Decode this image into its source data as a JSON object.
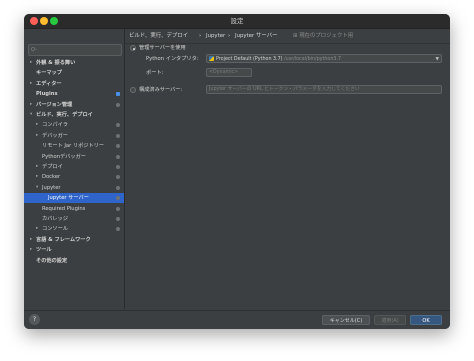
{
  "window": {
    "title": "設定"
  },
  "search": {
    "placeholder": "Q-"
  },
  "sidebar": {
    "items": [
      {
        "label": "外観 & 振る舞い",
        "arrow": "▸",
        "bold": true
      },
      {
        "label": "キーマップ",
        "arrow": "",
        "bold": true
      },
      {
        "label": "エディター",
        "arrow": "▸",
        "bold": true
      },
      {
        "label": "Plugins",
        "arrow": "",
        "bold": true
      },
      {
        "label": "バージョン管理",
        "arrow": "▸",
        "bold": true
      },
      {
        "label": "ビルド、実行、デプロイ",
        "arrow": "▾",
        "bold": true
      },
      {
        "label": "コンパイラ",
        "arrow": "▸",
        "bold": false
      },
      {
        "label": "デバッガー",
        "arrow": "▸",
        "bold": false
      },
      {
        "label": "リモート Jar リポジトリー",
        "arrow": "",
        "bold": false
      },
      {
        "label": "Pythonデバッガー",
        "arrow": "",
        "bold": false
      },
      {
        "label": "デプロイ",
        "arrow": "▸",
        "bold": false
      },
      {
        "label": "Docker",
        "arrow": "▸",
        "bold": false
      },
      {
        "label": "Jupyter",
        "arrow": "▾",
        "bold": false
      },
      {
        "label": "Jupyter サーバー",
        "arrow": "",
        "bold": false
      },
      {
        "label": "Required Plugins",
        "arrow": "",
        "bold": false
      },
      {
        "label": "カバレッジ",
        "arrow": "",
        "bold": false
      },
      {
        "label": "コンソール",
        "arrow": "▸",
        "bold": false
      },
      {
        "label": "言語 & フレームワーク",
        "arrow": "▸",
        "bold": true
      },
      {
        "label": "ツール",
        "arrow": "▸",
        "bold": true
      },
      {
        "label": "その他の設定",
        "arrow": "",
        "bold": true
      }
    ]
  },
  "breadcrumb": {
    "items": [
      "ビルド、実行、デプロイ",
      "Jupyter",
      "Jupyter サーバー"
    ],
    "separator": "›",
    "hint": "⊞ 現在のプロジェクト用"
  },
  "settings": {
    "managed_label": "管理サーバーを使用",
    "interpreter_label": "Python インタプリタ:",
    "interpreter_value": "Project Default (Python 3.7)",
    "interpreter_path": "/usr/local/bin/python3.7",
    "port_label": "ポート:",
    "port_placeholder": "<Dynamic>",
    "configured_label": "構成済みサーバー:",
    "configured_placeholder": "Jupyter サーバーの URL とトークン・パラメータを入力してください"
  },
  "footer": {
    "help_label": "?",
    "cancel_label": "キャンセル(C)",
    "apply_label": "適用(A)",
    "ok_label": "OK"
  },
  "colors": {
    "selection": "#2f65ca",
    "ok_button": "#365880",
    "window_bg": "#3c3f41"
  }
}
